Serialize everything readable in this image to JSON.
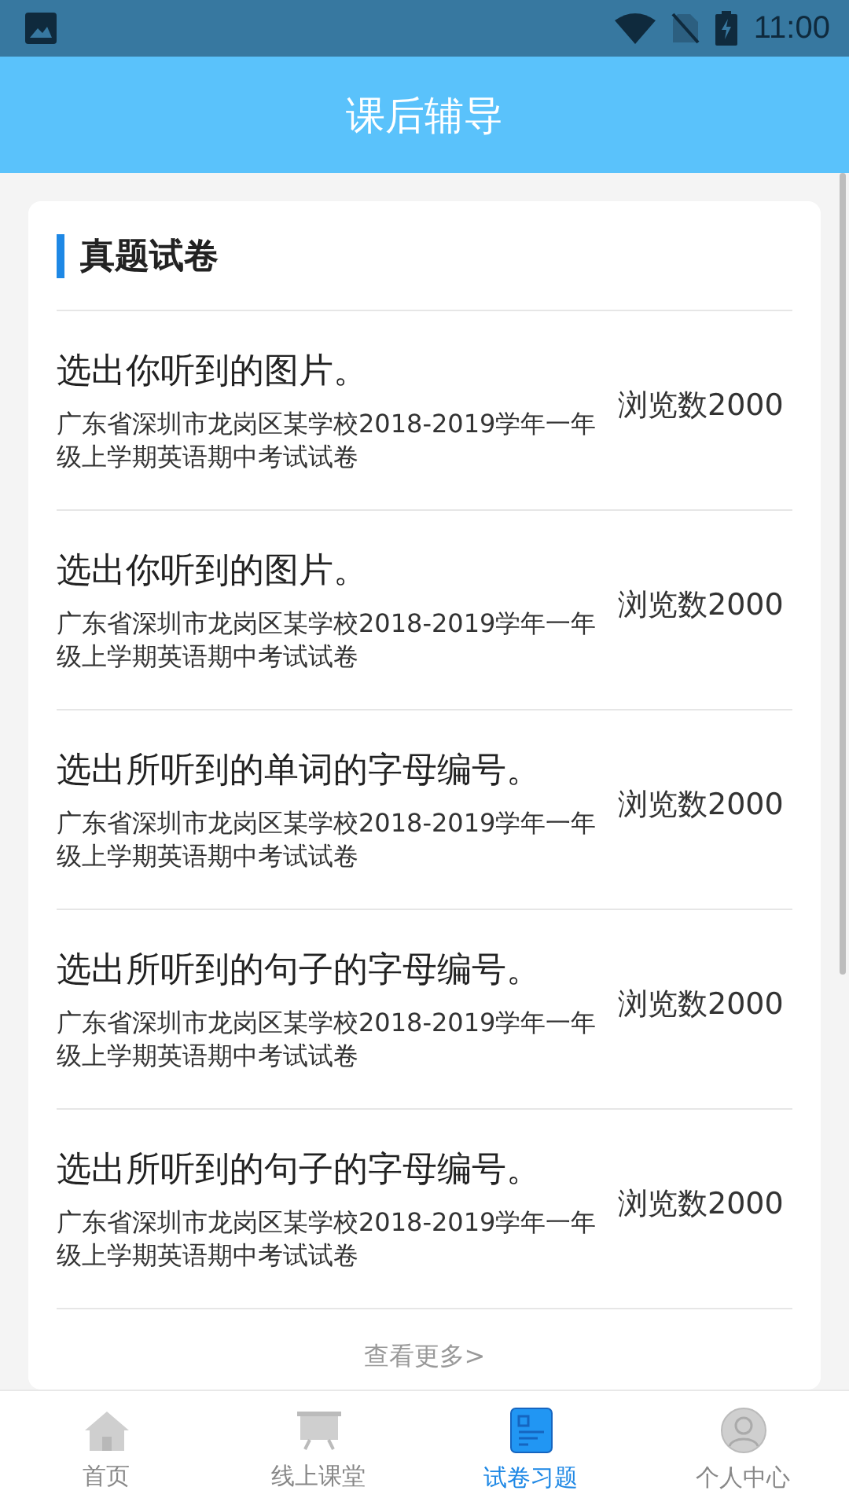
{
  "status_bar": {
    "time": "11:00"
  },
  "header": {
    "title": "课后辅导"
  },
  "section": {
    "title": "真题试卷"
  },
  "items": [
    {
      "title": "选出你听到的图片。",
      "source": "广东省深圳市龙岗区某学校2018-2019学年一年级上学期英语期中考试试卷",
      "views": "浏览数2000"
    },
    {
      "title": "选出你听到的图片。",
      "source": "广东省深圳市龙岗区某学校2018-2019学年一年级上学期英语期中考试试卷",
      "views": "浏览数2000"
    },
    {
      "title": "选出所听到的单词的字母编号。",
      "source": "广东省深圳市龙岗区某学校2018-2019学年一年级上学期英语期中考试试卷",
      "views": "浏览数2000"
    },
    {
      "title": "选出所听到的句子的字母编号。",
      "source": "广东省深圳市龙岗区某学校2018-2019学年一年级上学期英语期中考试试卷",
      "views": "浏览数2000"
    },
    {
      "title": "选出所听到的句子的字母编号。",
      "source": "广东省深圳市龙岗区某学校2018-2019学年一年级上学期英语期中考试试卷",
      "views": "浏览数2000"
    }
  ],
  "more": "查看更多>",
  "tabs": [
    {
      "kind": "home",
      "label": "首页",
      "selected": false
    },
    {
      "kind": "classroom",
      "label": "线上课堂",
      "selected": false
    },
    {
      "kind": "paper",
      "label": "试卷习题",
      "selected": true
    },
    {
      "kind": "profile",
      "label": "个人中心",
      "selected": false
    }
  ]
}
